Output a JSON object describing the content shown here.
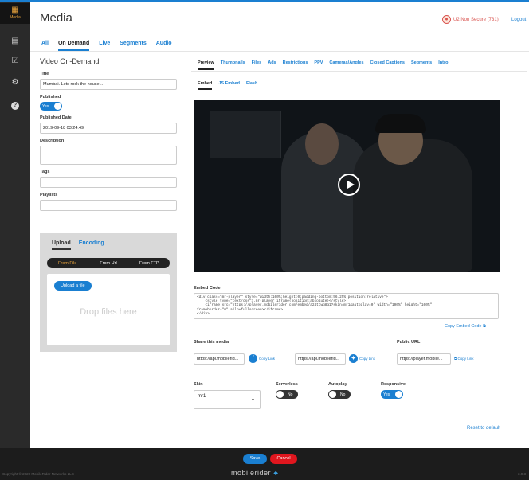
{
  "sidebar": {
    "logo_label": "Media",
    "items": [
      "media-library",
      "checklist",
      "settings",
      "help"
    ]
  },
  "header": {
    "title": "Media",
    "user": "U2 Non Secure (731)",
    "logout": "Logout"
  },
  "top_tabs": [
    "All",
    "On Demand",
    "Live",
    "Segments",
    "Audio"
  ],
  "left": {
    "heading": "Video On-Demand",
    "title_label": "Title",
    "title_value": "Mumbai. Lets rock the house...",
    "published_label": "Published",
    "published_toggle": "Yes",
    "published_date_label": "Published Date",
    "published_date_value": "2019-09-18 03:24:49",
    "description_label": "Description",
    "tags_label": "Tags",
    "playlists_label": "Playlists",
    "upload_tabs": [
      "Upload",
      "Encoding"
    ],
    "source_options": [
      "From File",
      "From Url",
      "From FTP"
    ],
    "upload_button": "Upload a file",
    "drop_text": "Drop files here"
  },
  "right": {
    "tabs": [
      "Preview",
      "Thumbnails",
      "Files",
      "Ads",
      "Restrictions",
      "PPV",
      "Cameras/Angles",
      "Closed Captions",
      "Segments",
      "Intro"
    ],
    "embed_tabs": [
      "Embed",
      "JS Embed",
      "Flash"
    ],
    "embed_heading": "Embed Code",
    "embed_code": "<div class=\"mr-player\" style=\"width:100%;height:0;padding-bottom:56.25%;position:relative\">\n    <style type=\"text/css\">.mr-player iframe{position:absolute}</style>\n    <iframe src=\"https://player.mobilerider.com/embed/a24ttwg8g1?skin=mr1&autoplay=0\" width=\"100%\" height=\"100%\"\nframeborder=\"0\" allowfullscreen></iframe>\n</div>",
    "copy_embed": "Copy Embed Code",
    "share_heading": "Share this media",
    "share_fb_url": "https://api.mobilerid...",
    "share_tw_url": "https://api.mobilerid...",
    "copy_link": "Copy Link",
    "public_url_heading": "Public URL",
    "public_url": "https://player.mobile...",
    "skin_label": "Skin",
    "skin_value": "mr1",
    "serverless_label": "Serverless",
    "serverless_value": "No",
    "autoplay_label": "Autoplay",
    "autoplay_value": "No",
    "responsive_label": "Responsive",
    "responsive_value": "Yes",
    "reset": "Reset to default"
  },
  "footer": {
    "save": "Save",
    "cancel": "Cancel",
    "copyright": "Copyright © 2020 MobileRider Networks LLC",
    "brand": "mobilerider",
    "version": "3.9.3"
  }
}
